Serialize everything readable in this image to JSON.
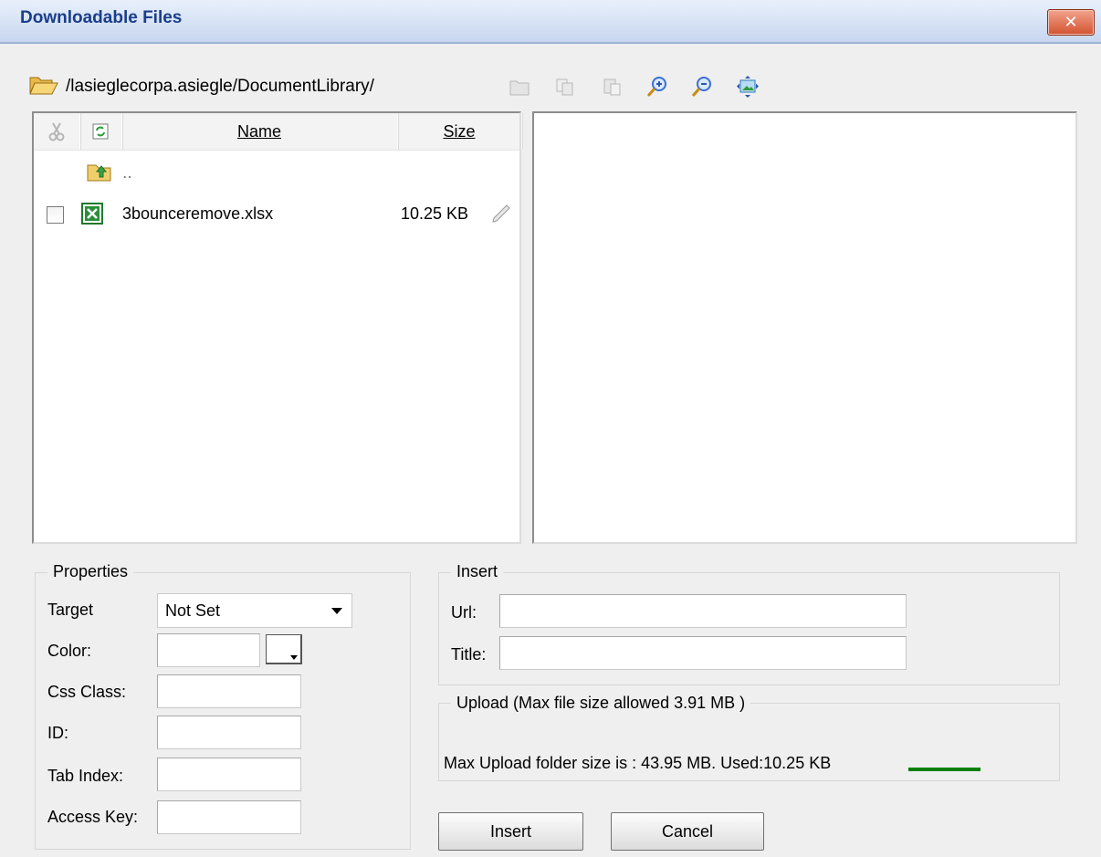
{
  "window": {
    "title": "Downloadable Files",
    "close_label": "✕"
  },
  "path": "/lasieglecorpa.asiegle/DocumentLibrary/",
  "toolbar": [
    "new-folder-icon",
    "copy-icon",
    "paste-icon",
    "zoom-in-icon",
    "zoom-out-icon",
    "fit-image-icon"
  ],
  "file_list": {
    "columns": {
      "name": "Name",
      "size": "Size"
    },
    "parent_label": "..",
    "files": [
      {
        "name": "3bounceremove.xlsx",
        "size": "10.25 KB",
        "type": "xlsx"
      }
    ]
  },
  "properties": {
    "legend": "Properties",
    "target_label": "Target",
    "target_value": "Not Set",
    "color_label": "Color:",
    "color_value": "",
    "css_class_label": "Css Class:",
    "css_class_value": "",
    "id_label": "ID:",
    "id_value": "",
    "tab_index_label": "Tab Index:",
    "tab_index_value": "",
    "access_key_label": "Access Key:",
    "access_key_value": ""
  },
  "insert_section": {
    "legend": "Insert",
    "url_label": "Url:",
    "url_value": "",
    "title_label": "Title:",
    "title_value": ""
  },
  "upload": {
    "legend": "Upload (Max file size allowed 3.91 MB )",
    "status_text": "Max Upload folder size is : 43.95 MB. Used:10.25 KB",
    "bar_color": "#008000"
  },
  "buttons": {
    "insert": "Insert",
    "cancel": "Cancel"
  }
}
